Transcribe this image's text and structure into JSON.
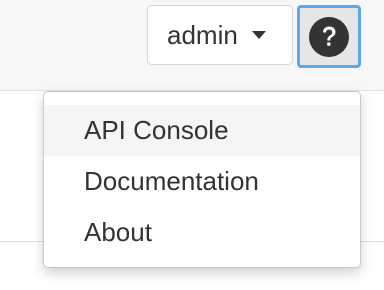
{
  "header": {
    "user_menu": {
      "label": "admin",
      "caret_icon": "caret-down-icon"
    },
    "help_button": {
      "icon": "question-circle-icon"
    }
  },
  "help_menu": {
    "items": [
      {
        "label": "API Console",
        "highlighted": true
      },
      {
        "label": "Documentation",
        "highlighted": false
      },
      {
        "label": "About",
        "highlighted": false
      }
    ]
  },
  "colors": {
    "focus_ring": "#5aa7f2",
    "icon": "#333333",
    "text": "#333333",
    "highlight": "#f5f5f5"
  }
}
